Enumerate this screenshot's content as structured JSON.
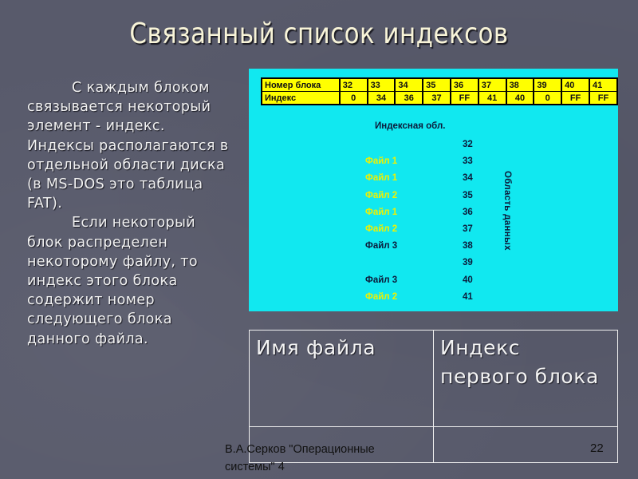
{
  "slide": {
    "title": "Связанный список индексов",
    "paragraphs": [
      "С каждым блоком связывается некоторый элемент - индекс. Индексы располагаются в отдельной области диска (в MS-DOS это таблица FAT).",
      "Если некоторый блок распределен некоторому файлу, то индекс этого блока содержит номер следующего блока данного файла."
    ]
  },
  "diagram": {
    "background_color": "#11e8f0",
    "table_color": "#ffff00",
    "block_table": {
      "row_labels": [
        "Номер блока",
        "Индекс"
      ],
      "block_numbers": [
        "32",
        "33",
        "34",
        "35",
        "36",
        "37",
        "38",
        "39",
        "40",
        "41"
      ],
      "indexes": [
        "0",
        "34",
        "36",
        "37",
        "FF",
        "41",
        "40",
        "0",
        "FF",
        "FF"
      ]
    },
    "index_area_title": "Индексная обл.",
    "data_area_label": "Область данных",
    "data_blocks": [
      {
        "file": "",
        "block": "32",
        "file_class": ""
      },
      {
        "file": "Файл 1",
        "block": "33",
        "file_class": "f1"
      },
      {
        "file": "Файл 1",
        "block": "34",
        "file_class": "f1"
      },
      {
        "file": "Файл 2",
        "block": "35",
        "file_class": "f2"
      },
      {
        "file": "Файл 1",
        "block": "36",
        "file_class": "f1"
      },
      {
        "file": "Файл 2",
        "block": "37",
        "file_class": "f2"
      },
      {
        "file": "Файл 3",
        "block": "38",
        "file_class": "f3"
      },
      {
        "file": "",
        "block": "39",
        "file_class": ""
      },
      {
        "file": "Файл 3",
        "block": "40",
        "file_class": "f3"
      },
      {
        "file": "Файл 2",
        "block": "41",
        "file_class": "f2"
      }
    ]
  },
  "file_table": {
    "headers": [
      "Имя файла",
      "Индекс первого блока"
    ],
    "rows": [
      [
        "",
        ""
      ]
    ]
  },
  "footer": {
    "author": "В.А.Серков \"Операционные системы\" 4",
    "page_number": "22"
  }
}
